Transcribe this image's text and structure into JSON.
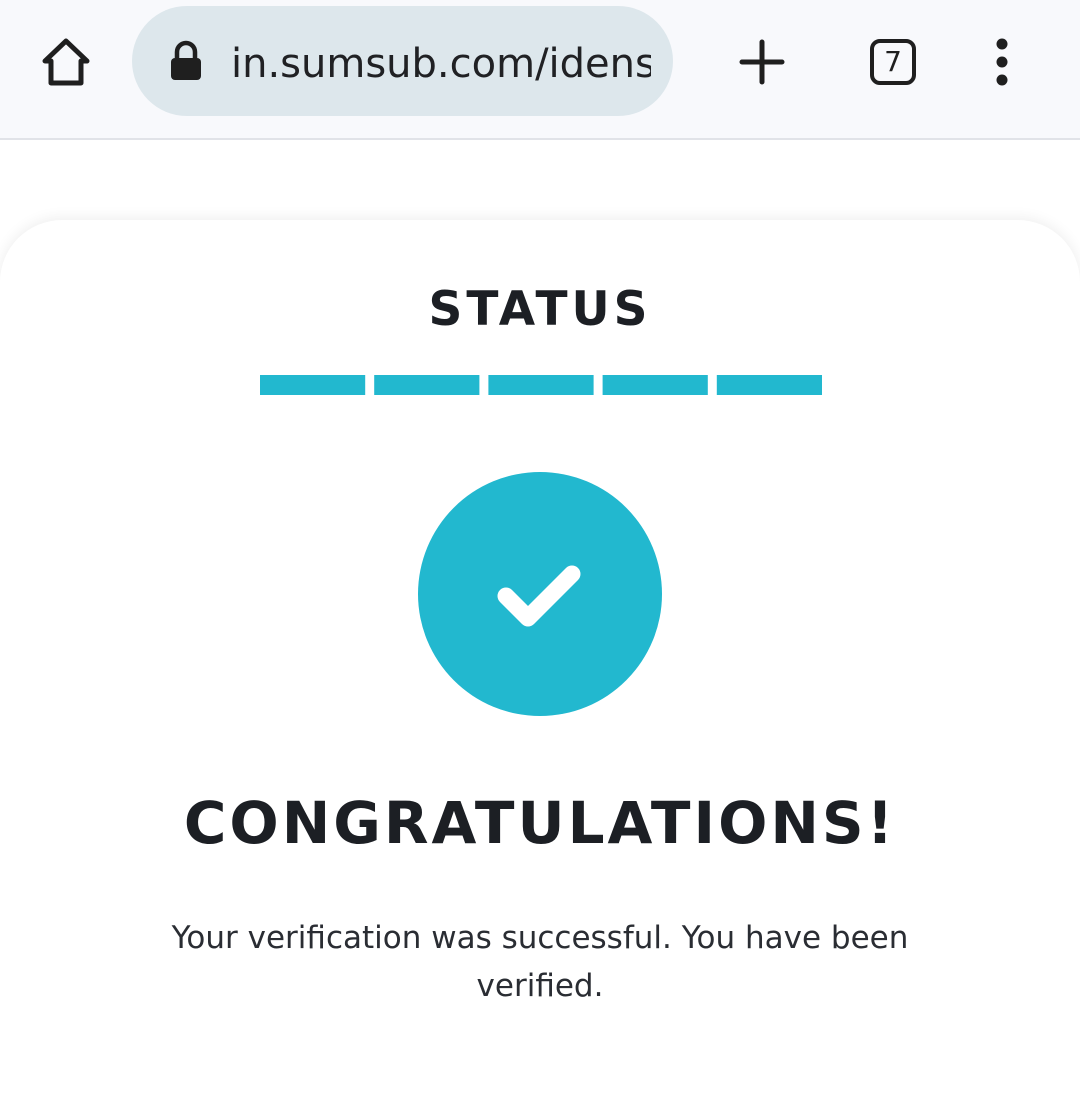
{
  "browser": {
    "url": "in.sumsub.com/idensic",
    "tab_count": "7",
    "icons": {
      "home": "home-icon",
      "lock": "lock-icon",
      "new_tab": "plus-icon",
      "tabs": "tab-switcher-icon",
      "menu": "more-vert-icon"
    }
  },
  "status": {
    "title": "STATUS",
    "steps_total": 5,
    "steps_completed": 5,
    "accent_color": "#22b8cf"
  },
  "result": {
    "icon": "check-icon",
    "heading": "CONGRATULATIONS!",
    "message": "Your verification was successful. You have been verified."
  }
}
